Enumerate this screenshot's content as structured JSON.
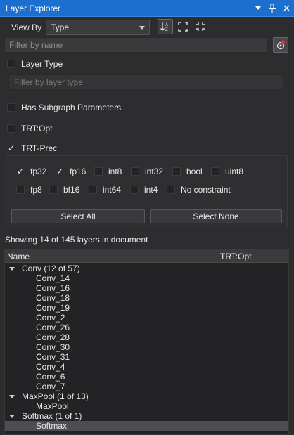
{
  "window": {
    "title": "Layer Explorer"
  },
  "toolbar": {
    "view_by_label": "View By",
    "view_by_value": "Type",
    "sort_icon": "sort-alpha-icon",
    "expand_icon": "expand-icon",
    "collapse_icon": "collapse-icon"
  },
  "filter": {
    "placeholder": "Filter by name"
  },
  "sections": {
    "layer_type": {
      "label": "Layer Type",
      "placeholder": "Filter by layer type",
      "checked": false
    },
    "subgraph": {
      "label": "Has Subgraph Parameters",
      "checked": false
    },
    "trt_opt": {
      "label": "TRT:Opt",
      "checked": false
    },
    "trt_prec": {
      "label": "TRT-Prec",
      "checked": true
    }
  },
  "precisions": [
    {
      "label": "fp32",
      "checked": true
    },
    {
      "label": "fp16",
      "checked": true
    },
    {
      "label": "int8",
      "checked": false
    },
    {
      "label": "int32",
      "checked": false
    },
    {
      "label": "bool",
      "checked": false
    },
    {
      "label": "uint8",
      "checked": false
    },
    {
      "label": "fp8",
      "checked": false
    },
    {
      "label": "bf16",
      "checked": false
    },
    {
      "label": "int64",
      "checked": false
    },
    {
      "label": "int4",
      "checked": false
    },
    {
      "label": "No constraint",
      "checked": false
    }
  ],
  "buttons": {
    "select_all": "Select All",
    "select_none": "Select None"
  },
  "status": "Showing 14 of 145 layers in document",
  "tree": {
    "columns": [
      "Name",
      "TRT:Opt"
    ],
    "groups": [
      {
        "label": "Conv (12 of 57)",
        "children": [
          "Conv_14",
          "Conv_16",
          "Conv_18",
          "Conv_19",
          "Conv_2",
          "Conv_26",
          "Conv_28",
          "Conv_30",
          "Conv_31",
          "Conv_4",
          "Conv_6",
          "Conv_7"
        ]
      },
      {
        "label": "MaxPool (1 of 13)",
        "children": [
          "MaxPool"
        ]
      },
      {
        "label": "Softmax (1 of 1)",
        "children": [
          "Softmax"
        ],
        "selected_child": "Softmax"
      }
    ]
  },
  "colors": {
    "title_bar": "#1c6fcf",
    "background": "#2d2d30",
    "badge": "#e03030"
  }
}
